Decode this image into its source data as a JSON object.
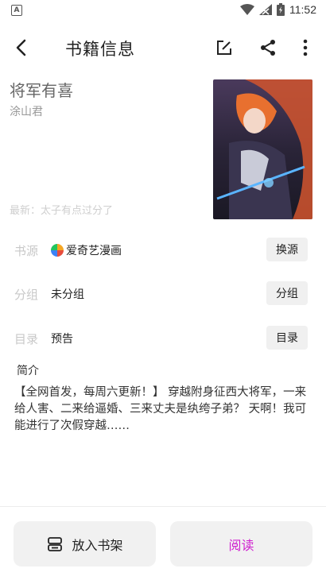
{
  "status_bar": {
    "time": "11:52",
    "left_badge": "A"
  },
  "toolbar": {
    "title": "书籍信息"
  },
  "book": {
    "title": "将军有喜",
    "author": "涂山君",
    "latest": "最新：太子有点过分了"
  },
  "info": {
    "source": {
      "label": "书源",
      "value": "爱奇艺漫画",
      "button": "换源"
    },
    "group": {
      "label": "分组",
      "value": "未分组",
      "button": "分组"
    },
    "toc": {
      "label": "目录",
      "value": "预告",
      "button": "目录"
    }
  },
  "intro": {
    "label": "简介",
    "text": "【全网首发，每周六更新！】 穿越附身征西大将军，一来给人害、二来给逼婚、三来丈夫是纨绔子弟？ 天啊！我可能进行了次假穿越……"
  },
  "actions": {
    "add_shelf": "放入书架",
    "read": "阅读"
  },
  "colors": {
    "read_accent": "#d020d0",
    "label_gray": "#c8c8c8"
  }
}
